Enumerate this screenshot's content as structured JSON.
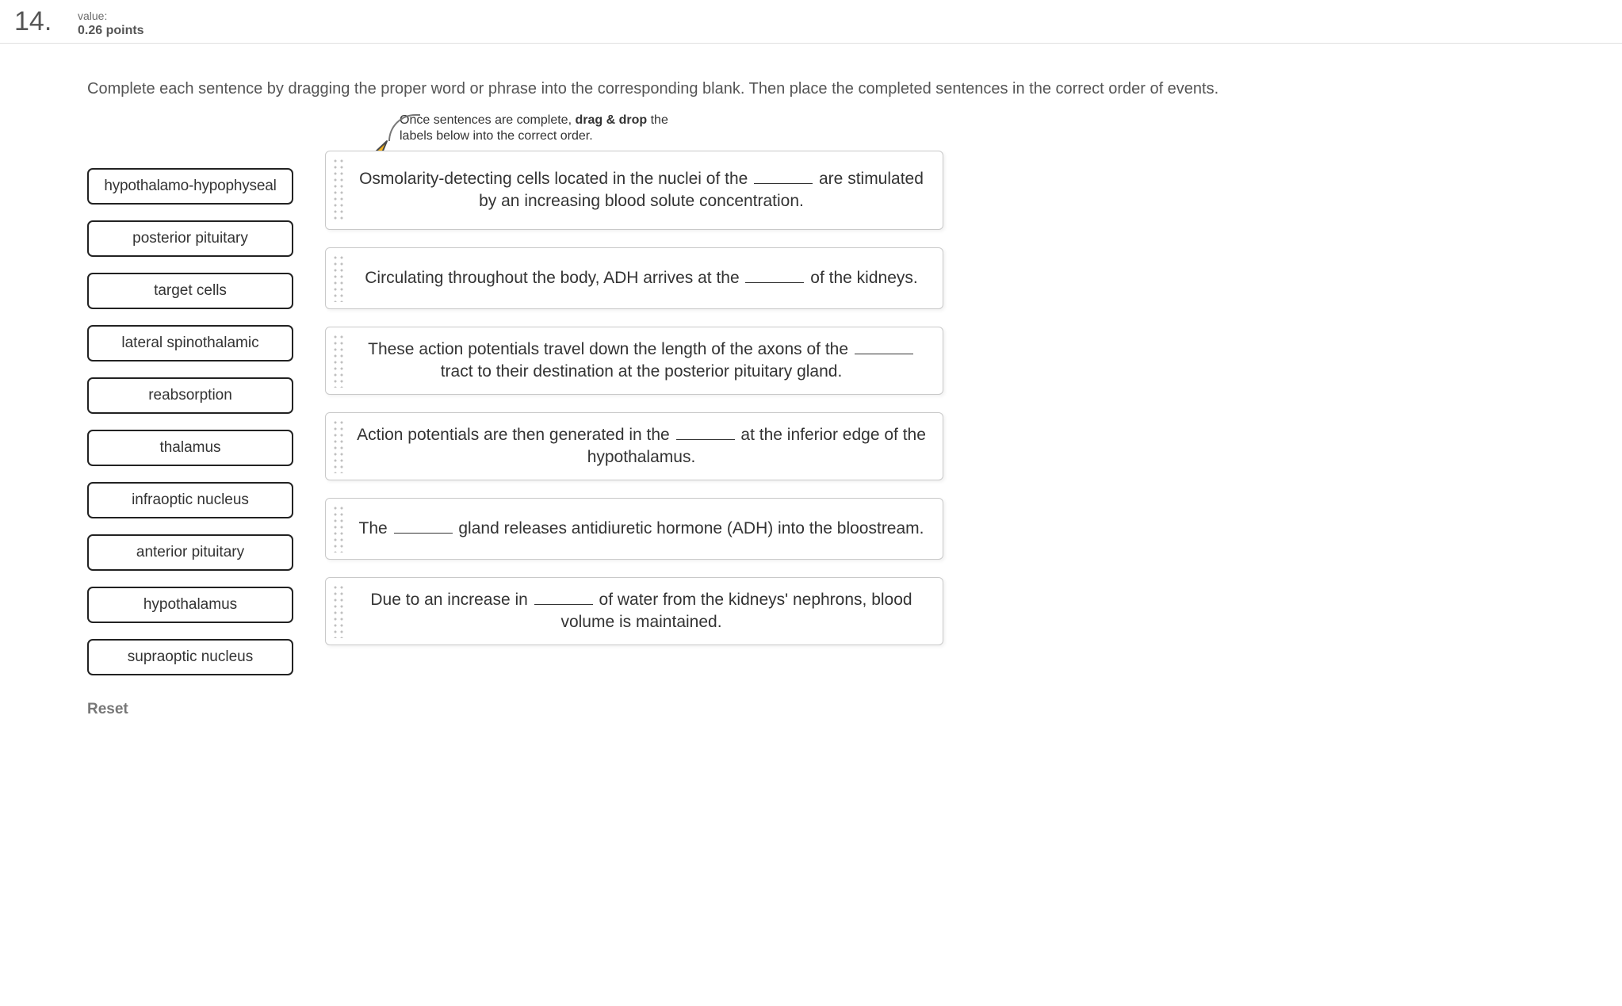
{
  "header": {
    "number": "14.",
    "value_label": "value:",
    "points": "0.26 points"
  },
  "instructions": "Complete each sentence by dragging the proper word or phrase into the corresponding blank. Then place the completed sentences in the correct order of events.",
  "order_note": {
    "line1_a": "Once sentences are complete,",
    "line1_b": "drag & drop",
    "line1_c": "the",
    "line2": "labels below into the correct order."
  },
  "chips": [
    "hypothalamo-hypophyseal",
    "posterior pituitary",
    "target cells",
    "lateral spinothalamic",
    "reabsorption",
    "thalamus",
    "infraoptic nucleus",
    "anterior pituitary",
    "hypothalamus",
    "supraoptic nucleus"
  ],
  "reset": "Reset",
  "sentences": [
    {
      "pre": "Osmolarity-detecting cells located in the nuclei of the ",
      "post": " are stimulated by an increasing blood solute concentration."
    },
    {
      "pre": "Circulating throughout the body, ADH arrives at the ",
      "post": " of the kidneys."
    },
    {
      "pre": "These action potentials travel down the length of the axons of the ",
      "post": " tract to their destination at the posterior pituitary gland."
    },
    {
      "pre": "Action potentials are then generated in the ",
      "post": " at the inferior edge of the hypothalamus."
    },
    {
      "pre": "The ",
      "post": " gland releases antidiuretic hormone (ADH) into the bloostream."
    },
    {
      "pre": "Due to an increase in ",
      "post": " of water from the kidneys' nephrons, blood volume is maintained."
    }
  ]
}
